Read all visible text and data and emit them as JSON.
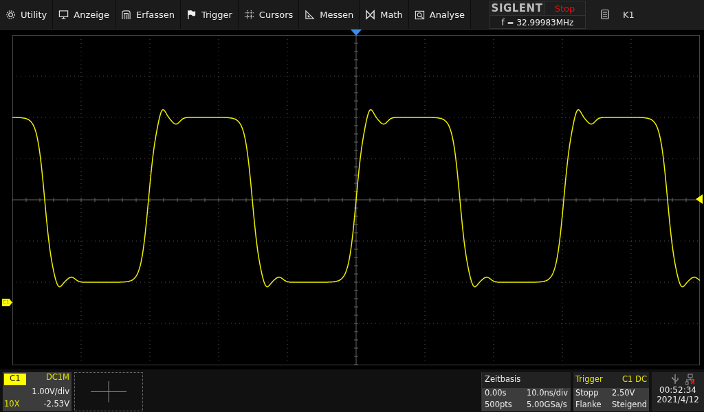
{
  "menu": [
    {
      "label": "Utility"
    },
    {
      "label": "Anzeige"
    },
    {
      "label": "Erfassen"
    },
    {
      "label": "Trigger"
    },
    {
      "label": "Cursors"
    },
    {
      "label": "Messen"
    },
    {
      "label": "Math"
    },
    {
      "label": "Analyse"
    }
  ],
  "brand": {
    "logo": "SIGLENT",
    "run_state": "Stop",
    "frequency": "f = 32.99983MHz"
  },
  "memory": {
    "label": "K1"
  },
  "channel_marker": "C1",
  "channel": {
    "name": "C1",
    "coupling": "DC1M",
    "scale": "1.00V/div",
    "probe": "10X",
    "offset": "-2.53V"
  },
  "timebase": {
    "title": "Zeitbasis",
    "delay": "0.00s",
    "scale": "10.0ns/div",
    "points": "500pts",
    "sample_rate": "5.00GSa/s"
  },
  "trigger": {
    "title": "Trigger",
    "source": "C1",
    "coupling": "DC",
    "mode": "Stopp",
    "trigger_level": "2.50V",
    "type": "Flanke",
    "slope": "Steigend"
  },
  "status": {
    "time": "00:52:34",
    "date": "2021/4/12"
  }
}
